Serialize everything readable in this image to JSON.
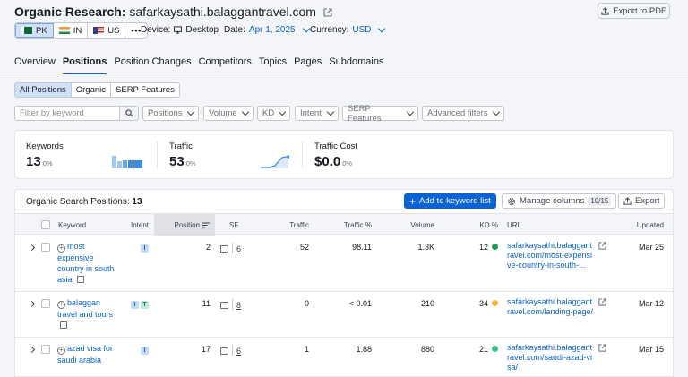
{
  "header": {
    "title": "Organic Research:",
    "domain": "safarkaysathi.balaggantravel.com",
    "export_pdf": "Export to PDF"
  },
  "databases": [
    {
      "code": "PK",
      "active": true
    },
    {
      "code": "IN",
      "active": false
    },
    {
      "code": "US",
      "active": false
    }
  ],
  "meta": {
    "device_label": "Device:",
    "device_value": "Desktop",
    "date_label": "Date:",
    "date_value": "Apr 1, 2025",
    "currency_label": "Currency:",
    "currency_value": "USD"
  },
  "tabs": [
    "Overview",
    "Positions",
    "Position Changes",
    "Competitors",
    "Topics",
    "Pages",
    "Subdomains"
  ],
  "active_tab": "Positions",
  "subtabs": [
    "All Positions",
    "Organic",
    "SERP Features"
  ],
  "filters": {
    "keyword_placeholder": "Filter by keyword",
    "dropdowns": [
      "Positions",
      "Volume",
      "KD",
      "Intent",
      "SERP Features",
      "Advanced filters"
    ]
  },
  "summary": {
    "keywords": {
      "label": "Keywords",
      "value": "13",
      "pct": "0%"
    },
    "traffic": {
      "label": "Traffic",
      "value": "53",
      "pct": "0%"
    },
    "traffic_cost": {
      "label": "Traffic Cost",
      "value": "$0.0",
      "pct": "0%"
    }
  },
  "table": {
    "title": "Organic Search Positions:",
    "count": "13",
    "add_button": "Add to keyword list",
    "manage_columns": "Manage columns",
    "columns_count": "10/15",
    "export_button": "Export",
    "headers": {
      "keyword": "Keyword",
      "intent": "Intent",
      "position": "Position",
      "sf": "SF",
      "traffic": "Traffic",
      "traffic_pct": "Traffic %",
      "volume": "Volume",
      "kd": "KD %",
      "url": "URL",
      "updated": "Updated"
    },
    "rows": [
      {
        "keyword": "most expensive country in south asia",
        "intent": [
          "I"
        ],
        "position": "2",
        "sf": "6",
        "traffic": "52",
        "traffic_pct": "98.11",
        "volume": "1.3K",
        "kd": "12",
        "kd_color": "#1a9e55",
        "url": "safarkaysathi.balaggantravel.com/most-expensive-country-in-south-...",
        "updated": "Mar 25"
      },
      {
        "keyword": "balaggan travel and tours",
        "intent": [
          "I",
          "T"
        ],
        "position": "11",
        "sf": "8",
        "traffic": "0",
        "traffic_pct": "< 0.01",
        "volume": "210",
        "kd": "34",
        "kd_color": "#f5b931",
        "url": "safarkaysathi.balaggantravel.com/landing-page/",
        "updated": "Mar 12"
      },
      {
        "keyword": "azad visa for saudi arabia",
        "intent": [
          "I"
        ],
        "position": "17",
        "sf": "6",
        "traffic": "1",
        "traffic_pct": "1.88",
        "volume": "880",
        "kd": "21",
        "kd_color": "#3cc08a",
        "url": "safarkaysathi.balaggantravel.com/saudi-azad-visa/",
        "updated": "Mar 15"
      }
    ]
  },
  "colors": {
    "accent": "#0a63d6",
    "background": "#f4f5f9"
  }
}
